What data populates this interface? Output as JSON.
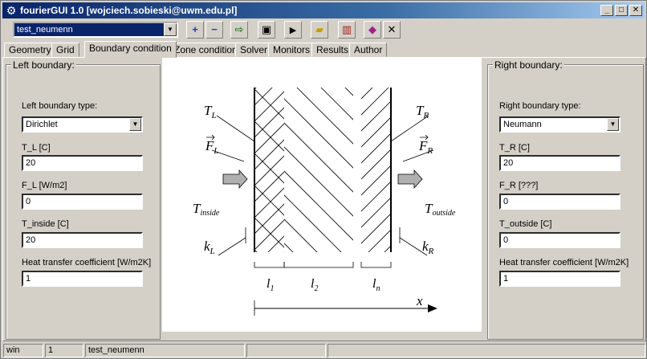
{
  "window": {
    "title": "fourierGUI 1.0 [wojciech.sobieski@uwm.edu.pl]"
  },
  "toolbar": {
    "project_select": "test_neumenn",
    "buttons": [
      "add-icon",
      "remove-icon",
      "export-icon",
      "save-icon",
      "run-icon",
      "open-folder-icon",
      "chart-icon",
      "book-icon",
      "close-icon"
    ]
  },
  "tabs": [
    {
      "label": "Geometry"
    },
    {
      "label": "Grid"
    },
    {
      "label": "Boundary condition",
      "active": true
    },
    {
      "label": "Zone condition"
    },
    {
      "label": "Solver"
    },
    {
      "label": "Monitors"
    },
    {
      "label": "Results"
    },
    {
      "label": "Author"
    }
  ],
  "left": {
    "title": "Left boundary:",
    "type_label": "Left boundary type:",
    "type_value": "Dirichlet",
    "fields": [
      {
        "label": "T_L [C]",
        "value": "20"
      },
      {
        "label": "F_L [W/m2]",
        "value": "0"
      },
      {
        "label": "T_inside [C]",
        "value": "20"
      },
      {
        "label": "Heat transfer coefficient [W/m2K]",
        "value": "1"
      }
    ]
  },
  "right": {
    "title": "Right boundary:",
    "type_label": "Right boundary type:",
    "type_value": "Neumann",
    "fields": [
      {
        "label": "T_R [C]",
        "value": "20"
      },
      {
        "label": "F_R [???]",
        "value": "0"
      },
      {
        "label": "T_outside [C]",
        "value": "0"
      },
      {
        "label": "Heat transfer coefficient [W/m2K]",
        "value": "1"
      }
    ]
  },
  "diagram": {
    "TL_main": "T",
    "TL_sub": "L",
    "FL_main": "F",
    "FL_sub": "L",
    "Tin_main": "T",
    "Tin_sub": "inside",
    "kL_main": "k",
    "kL_sub": "L",
    "TR_main": "T",
    "TR_sub": "R",
    "FR_main": "F",
    "FR_sub": "R",
    "Tout_main": "T",
    "Tout_sub": "outside",
    "kR_main": "k",
    "kR_sub": "R",
    "l1_main": "l",
    "l1_sub": "1",
    "l2_main": "l",
    "l2_sub": "2",
    "ln_main": "l",
    "ln_sub": "n",
    "x_label": "x"
  },
  "status": {
    "platform": "win",
    "count": "1",
    "project": "test_neumenn"
  }
}
